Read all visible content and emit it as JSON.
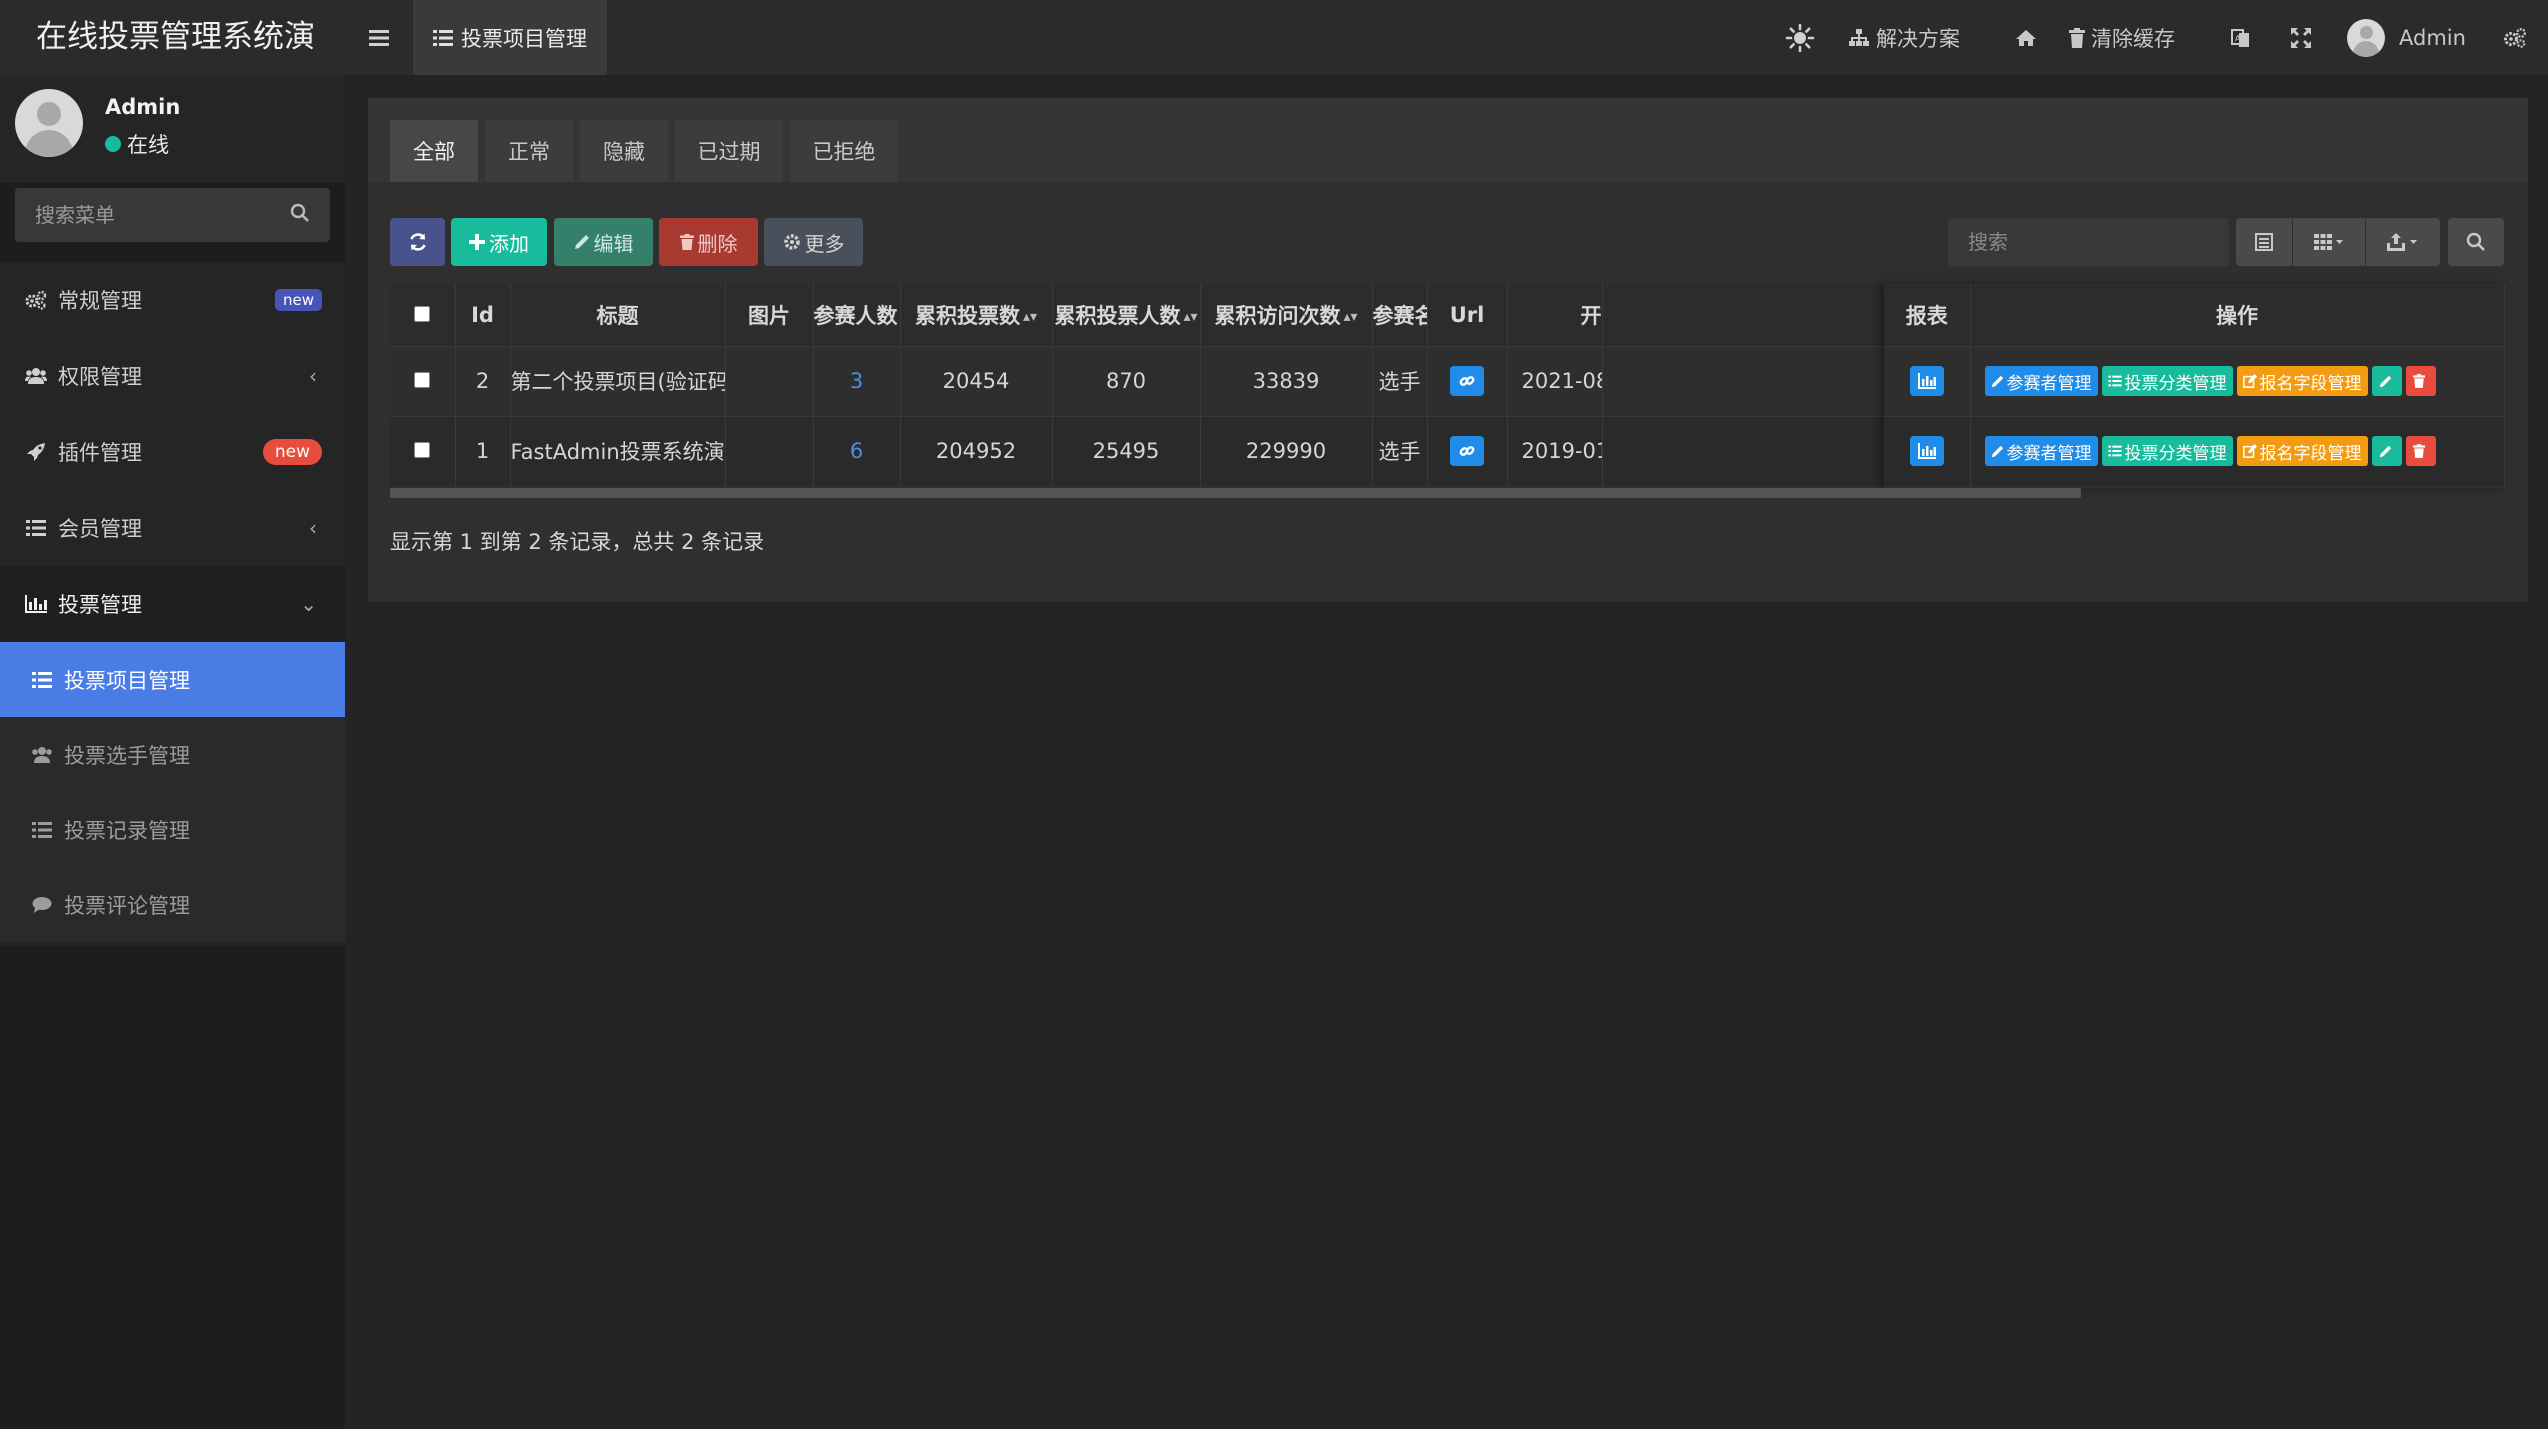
{
  "app": {
    "title": "在线投票管理系统演",
    "user": {
      "name": "Admin",
      "status": "在线"
    }
  },
  "sidebar": {
    "search_placeholder": "搜索菜单",
    "items": [
      {
        "label": "常规管理",
        "icon": "gears-icon",
        "badge": "new"
      },
      {
        "label": "权限管理",
        "icon": "users-icon"
      },
      {
        "label": "插件管理",
        "icon": "rocket-icon",
        "badge": "new"
      },
      {
        "label": "会员管理",
        "icon": "list-icon"
      },
      {
        "label": "投票管理",
        "icon": "bar-chart-icon"
      }
    ],
    "sub_items": [
      {
        "label": "投票项目管理",
        "icon": "list-icon"
      },
      {
        "label": "投票选手管理",
        "icon": "users-icon"
      },
      {
        "label": "投票记录管理",
        "icon": "list-icon"
      },
      {
        "label": "投票评论管理",
        "icon": "comment-icon"
      }
    ]
  },
  "topbar": {
    "page_tab": "投票项目管理",
    "solutions": "解决方案",
    "clear_cache": "清除缓存",
    "user": "Admin"
  },
  "status_tabs": [
    "全部",
    "正常",
    "隐藏",
    "已过期",
    "已拒绝"
  ],
  "toolbar": {
    "add": "添加",
    "edit": "编辑",
    "delete": "删除",
    "more": "更多",
    "search_placeholder": "搜索"
  },
  "table": {
    "columns": [
      "Id",
      "标题",
      "图片",
      "参赛人数",
      "累积投票数",
      "累积投票人数",
      "累积访问次数",
      "参赛名称",
      "Url",
      "开"
    ],
    "fixed_columns": [
      "报表",
      "操作"
    ],
    "rows": [
      {
        "id": "2",
        "title": "第二个投票项目(验证码+有限制)",
        "image": "",
        "participants": "3",
        "votes": "20454",
        "voters": "870",
        "visits": "33839",
        "entrant_name": "选手",
        "start": "2021-08"
      },
      {
        "id": "1",
        "title": "FastAdmin投票系统演示",
        "image": "",
        "participants": "6",
        "votes": "204952",
        "voters": "25495",
        "visits": "229990",
        "entrant_name": "选手",
        "start": "2019-01"
      }
    ],
    "operations": {
      "participants": "参赛者管理",
      "category": "投票分类管理",
      "signup_fields": "报名字段管理"
    }
  },
  "pager": {
    "text": "显示第 1 到第 2 条记录，总共 2 条记录"
  },
  "colors": {
    "accent": "#4a7ce6",
    "success": "#18bc9c",
    "danger": "#e74c3c",
    "warning": "#f39c12",
    "info": "#1e8ce8"
  }
}
